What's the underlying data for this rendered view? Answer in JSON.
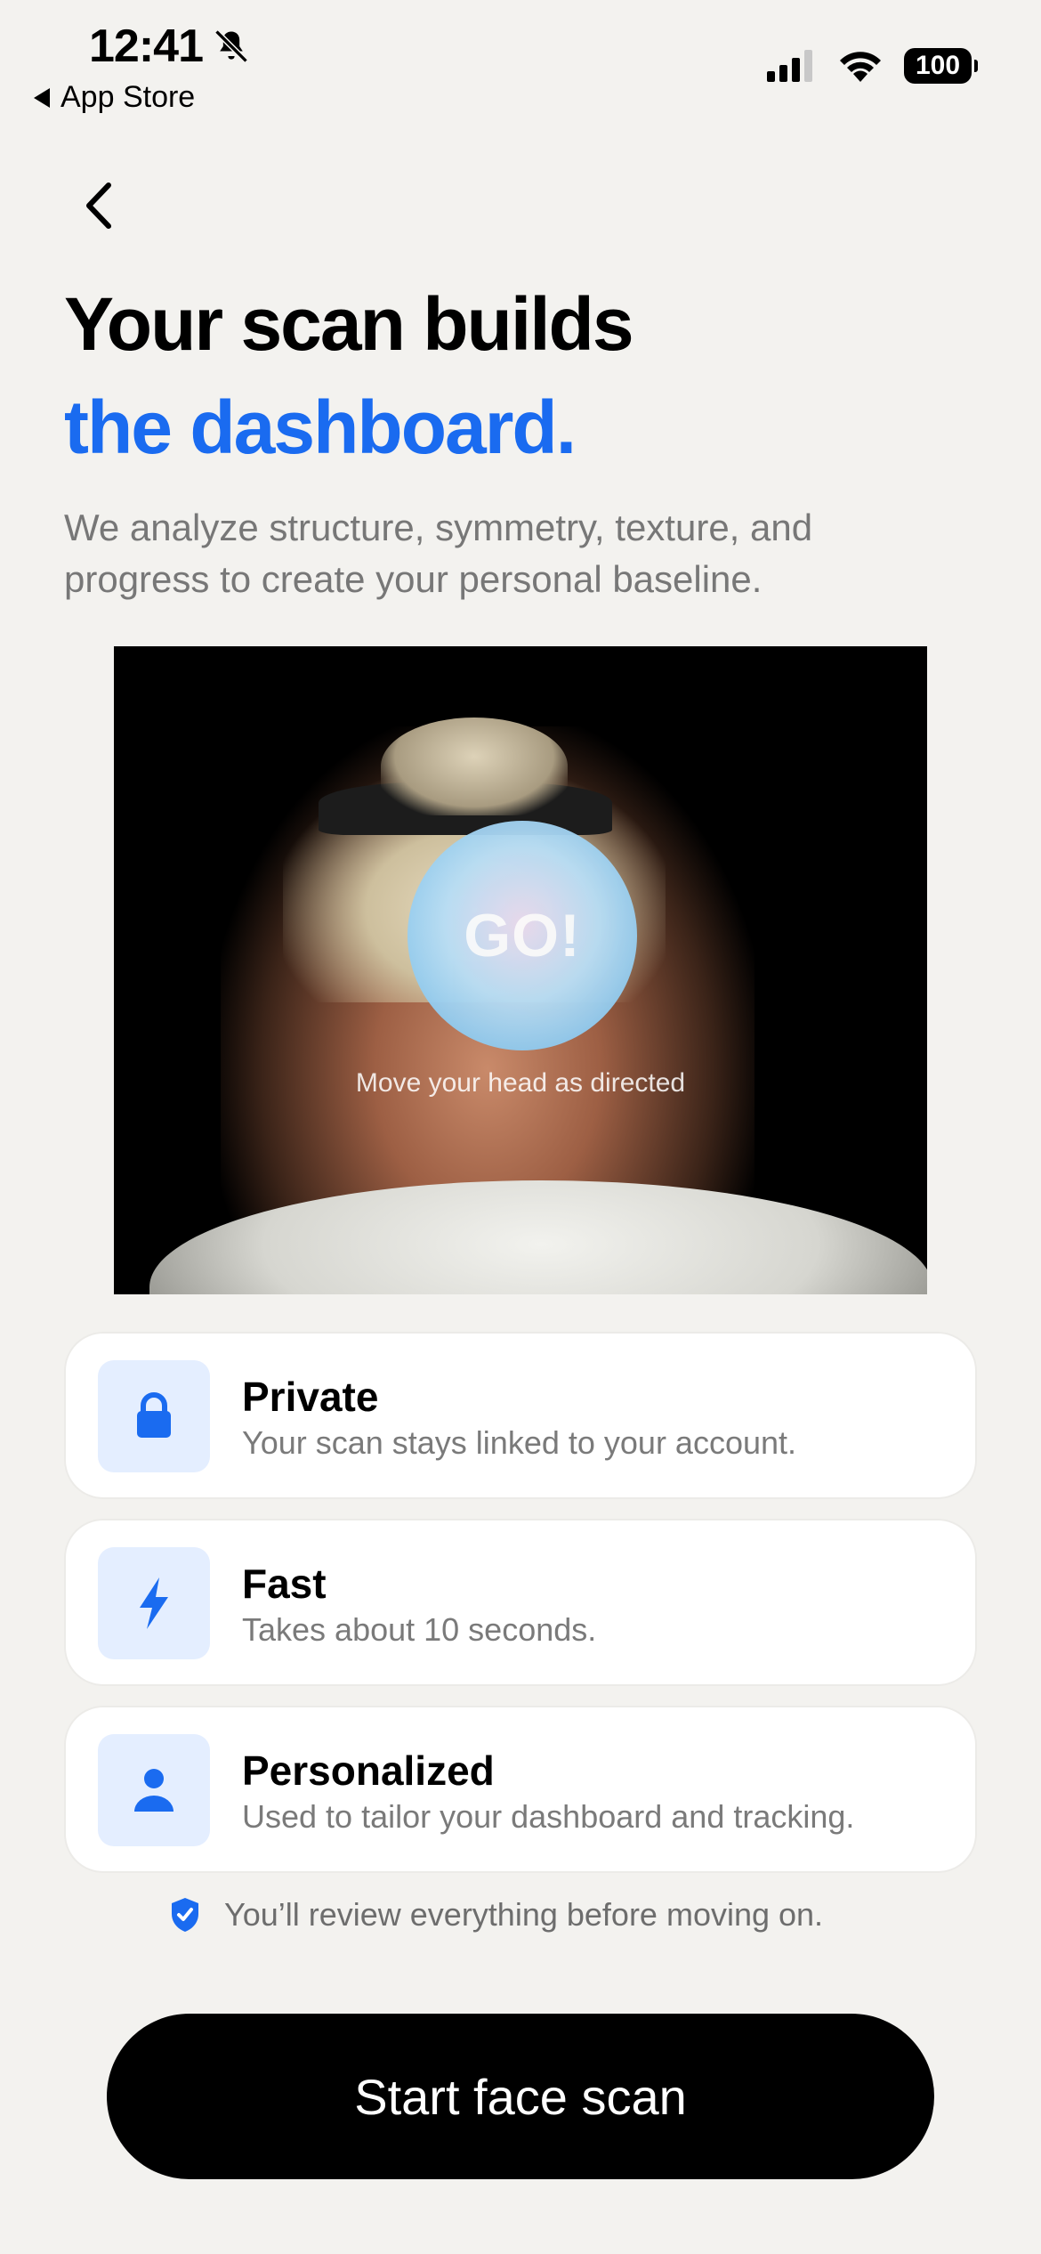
{
  "status_bar": {
    "time": "12:41",
    "back_to_app": "App Store",
    "battery": "100"
  },
  "header": {
    "title_line1": "Your scan builds",
    "title_line2": "the dashboard.",
    "subtitle": "We analyze structure, symmetry, texture, and progress to create your personal baseline."
  },
  "media": {
    "overlay_text": "GO!",
    "caption": "Move your head as directed"
  },
  "features": [
    {
      "title": "Private",
      "description": "Your scan stays linked to your account.",
      "icon": "lock-icon"
    },
    {
      "title": "Fast",
      "description": "Takes about 10 seconds.",
      "icon": "lightning-icon"
    },
    {
      "title": "Personalized",
      "description": "Used to tailor your dashboard and tracking.",
      "icon": "person-icon"
    }
  ],
  "note": "You’ll review everything before moving on.",
  "cta_label": "Start face scan",
  "colors": {
    "accent": "#1A6BF0",
    "icon_tile_bg": "#E4EEFF",
    "background": "#F3F2EF"
  }
}
